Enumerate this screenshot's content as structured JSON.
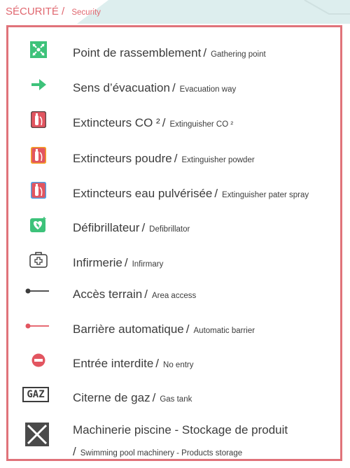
{
  "header": {
    "title_fr": "SÉCURITÉ /",
    "title_en": "Security"
  },
  "items": [
    {
      "fr": "Point de rassemblement",
      "en": "Gathering point",
      "icon": "gathering-point-icon"
    },
    {
      "fr": "Sens d’évacuation",
      "en": "Evacuation way",
      "icon": "arrow-right-icon"
    },
    {
      "fr": "Extincteurs CO ²",
      "en": "Extinguisher CO ²",
      "icon": "extinguisher-co2-icon"
    },
    {
      "fr": "Extincteurs poudre",
      "en": "Extinguisher powder",
      "icon": "extinguisher-powder-icon"
    },
    {
      "fr": "Extincteurs eau pulvérisée",
      "en": "Extinguisher pater spray",
      "icon": "extinguisher-water-icon"
    },
    {
      "fr": "Défibrillateur",
      "en": "Defibrillator",
      "icon": "defibrillator-icon"
    },
    {
      "fr": "Infirmerie",
      "en": "Infirmary",
      "icon": "first-aid-kit-icon"
    },
    {
      "fr": "Accès terrain",
      "en": "Area access",
      "icon": "area-access-icon"
    },
    {
      "fr": "Barrière automatique",
      "en": "Automatic barrier",
      "icon": "barrier-icon"
    },
    {
      "fr": "Entrée interdite",
      "en": "No entry",
      "icon": "no-entry-icon"
    },
    {
      "fr": "Citerne de gaz",
      "en": "Gas tank",
      "icon": "gas-tank-icon",
      "badge": "GAZ"
    },
    {
      "fr": "Machinerie piscine - Stockage de produit",
      "en": "Swimming pool machinery - Products storage",
      "icon": "crossed-box-icon"
    }
  ],
  "colors": {
    "accent": "#e0676f",
    "green": "#3dc27a",
    "red": "#e25560",
    "gray": "#3c3c3c"
  }
}
